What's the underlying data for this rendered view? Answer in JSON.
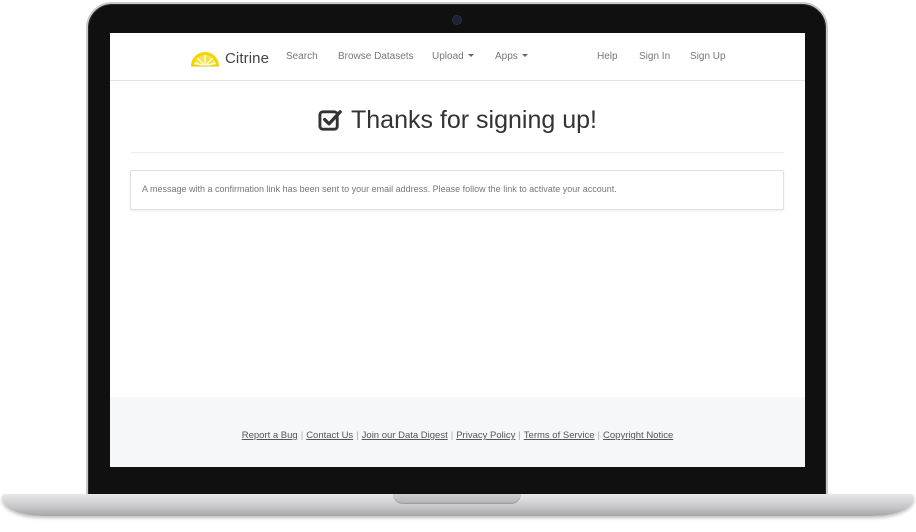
{
  "navbar": {
    "brand": "Citrine",
    "links": {
      "search": "Search",
      "browse": "Browse Datasets",
      "upload": "Upload",
      "apps": "Apps",
      "help": "Help",
      "sign_in": "Sign In",
      "sign_up": "Sign Up"
    }
  },
  "main": {
    "heading": "Thanks for signing up!",
    "message": "A message with a confirmation link has been sent to your email address. Please follow the link to activate your account."
  },
  "footer": {
    "links": [
      "Report a Bug",
      "Contact Us",
      "Join our Data Digest",
      "Privacy Policy",
      "Terms of Service",
      "Copyright Notice"
    ]
  },
  "colors": {
    "brand_yellow": "#f2d600",
    "text_dark": "#333333",
    "text_muted": "#777777",
    "footer_bg": "#f6f7f9"
  },
  "icons": {
    "brand_logo": "citrine-lemon-slice-icon",
    "heading_icon": "check-square-icon"
  }
}
